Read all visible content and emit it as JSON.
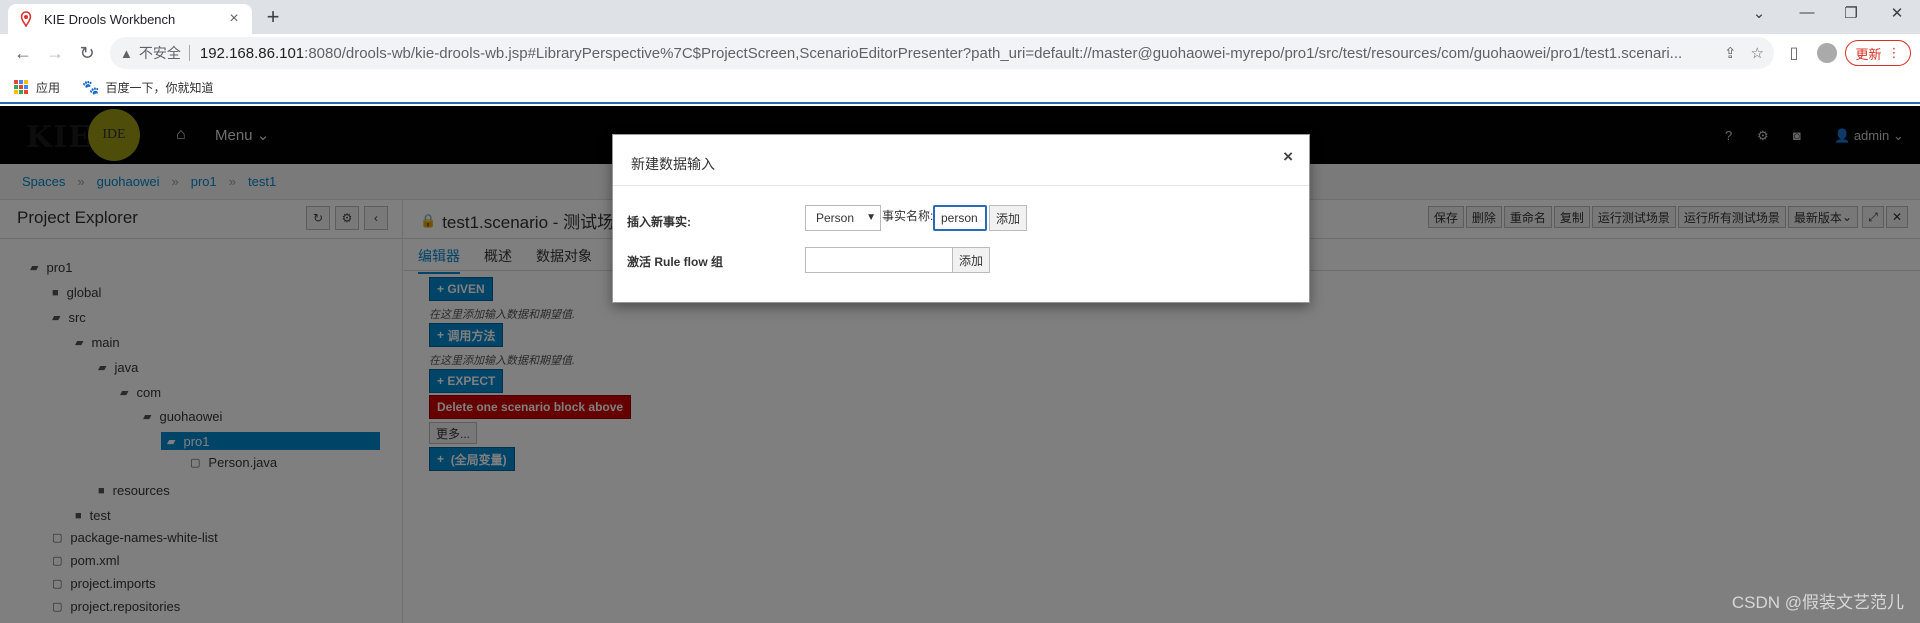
{
  "browser": {
    "tab_title": "KIE Drools Workbench",
    "insecure_label": "不安全",
    "url_host": "192.168.86.101",
    "url_rest": ":8080/drools-wb/kie-drools-wb.jsp#LibraryPerspective%7C$ProjectScreen,ScenarioEditorPresenter?path_uri=default://master@guohaowei-myrepo/pro1/src/test/resources/com/guohaowei/pro1/test1.scenari...",
    "update_label": "更新",
    "bookmarks": [
      {
        "label": "应用"
      },
      {
        "label": "百度一下，你就知道"
      }
    ]
  },
  "app": {
    "logo_text": "KIE",
    "logo_badge": "IDE",
    "menu_label": "Menu",
    "help_label": "?",
    "user_label": "admin"
  },
  "breadcrumb": [
    "Spaces",
    "guohaowei",
    "pro1",
    "test1"
  ],
  "explorer": {
    "title": "Project Explorer",
    "tree": [
      {
        "label": "pro1"
      },
      {
        "label": "global"
      },
      {
        "label": "src"
      },
      {
        "label": "main"
      },
      {
        "label": "java"
      },
      {
        "label": "com"
      },
      {
        "label": "guohaowei"
      },
      {
        "label": "pro1"
      },
      {
        "label": "Person.java"
      },
      {
        "label": "resources"
      },
      {
        "label": "test"
      },
      {
        "label": "package-names-white-list"
      },
      {
        "label": "pom.xml"
      },
      {
        "label": "project.imports"
      },
      {
        "label": "project.repositories"
      }
    ]
  },
  "editor": {
    "title": "test1.scenario - 测试场景",
    "tabs": [
      "编辑器",
      "概述",
      "数据对象"
    ],
    "actions": [
      "保存",
      "删除",
      "重命名",
      "复制",
      "运行测试场景",
      "运行所有测试场景",
      "最新版本"
    ],
    "given_label": "GIVEN",
    "hint1": "在这里添加输入数据和期望值.",
    "call_method_label": "调用方法",
    "hint2": "在这里添加输入数据和期望值.",
    "expect_label": "EXPECT",
    "delete_block_label": "Delete one scenario block above",
    "more_label": "更多...",
    "globals_label": "(全局变量)"
  },
  "modal": {
    "title": "新建数据输入",
    "close_label": "×",
    "insert_fact_label": "插入新事实:",
    "fact_type_selected": "Person",
    "fact_name_label": "事实名称:",
    "fact_name_value": "person",
    "add_label": "添加",
    "activate_label": "激活 Rule flow 组",
    "ruleflow_value": "",
    "add_label2": "添加"
  },
  "watermark": "CSDN @假装文艺范儿"
}
